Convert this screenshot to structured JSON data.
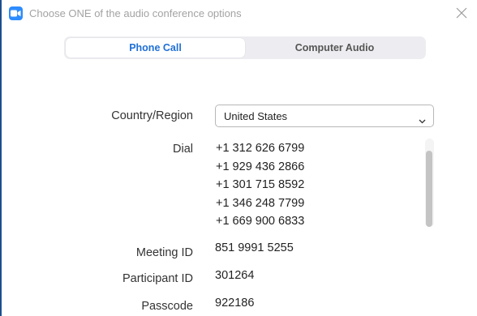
{
  "window": {
    "title": "Choose ONE of the audio conference options",
    "accent_color": "#2d8cff",
    "border_color": "#1a4f8f"
  },
  "tabs": [
    {
      "label": "Phone Call",
      "active": true
    },
    {
      "label": "Computer Audio",
      "active": false
    }
  ],
  "form": {
    "country_label": "Country/Region",
    "country_value": "United States",
    "dial_label": "Dial",
    "dial_numbers": [
      "+1 312 626 6799",
      "+1 929 436 2866",
      "+1 301 715 8592",
      "+1 346 248 7799",
      "+1 669 900 6833"
    ],
    "meeting_id_label": "Meeting ID",
    "meeting_id_value": "851 9991 5255",
    "participant_id_label": "Participant ID",
    "participant_id_value": "301264",
    "passcode_label": "Passcode",
    "passcode_value": "922186"
  },
  "icons": {
    "app": "zoom-camera-icon",
    "close": "close-icon",
    "dropdown": "chevron-down-icon"
  }
}
